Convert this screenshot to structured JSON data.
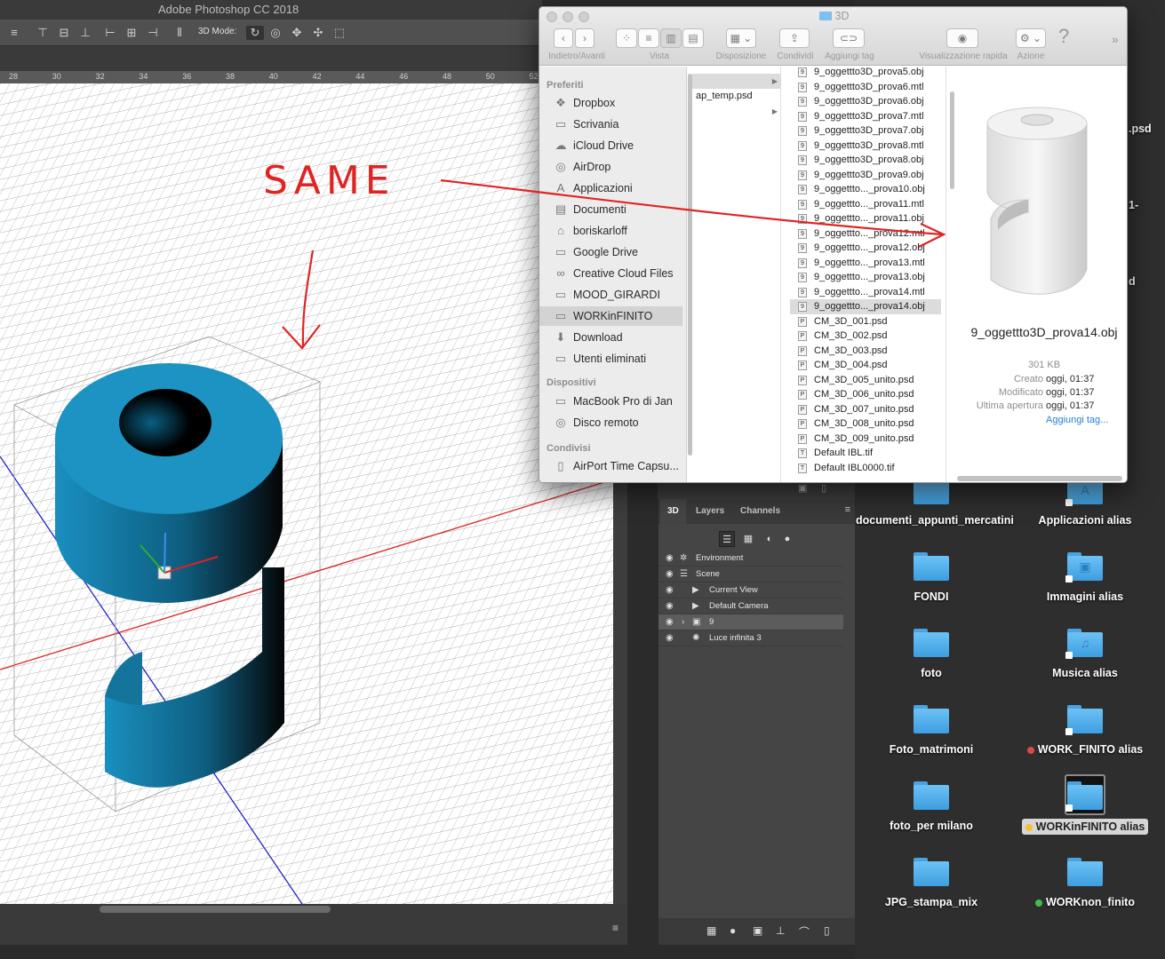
{
  "photoshop": {
    "title": "Adobe Photoshop CC 2018",
    "mode_label": "3D Mode:",
    "ruler_ticks": [
      "28",
      "30",
      "32",
      "34",
      "36",
      "38",
      "40",
      "42",
      "44",
      "46",
      "48",
      "50",
      "52"
    ],
    "panel_tabs": [
      "3D",
      "Layers",
      "Channels"
    ],
    "layers": [
      {
        "name": "Environment",
        "icon": "environment-icon"
      },
      {
        "name": "Scene",
        "icon": "scene-icon"
      },
      {
        "name": "Current View",
        "icon": "camera-icon"
      },
      {
        "name": "Default Camera",
        "icon": "camera-icon"
      },
      {
        "name": "9",
        "icon": "mesh-icon"
      },
      {
        "name": "Luce infinita 3",
        "icon": "light-icon"
      }
    ]
  },
  "annotation": {
    "text": "SAME"
  },
  "finder": {
    "title": "3D",
    "toolbar": {
      "back_forward": "Indietro/Avanti",
      "view": "Vista",
      "arrange": "Disposizione",
      "share": "Condividi",
      "tags": "Aggiungi tag",
      "quicklook": "Visualizzazione rapida",
      "action": "Azione"
    },
    "sidebar": {
      "favorites_header": "Preferiti",
      "favorites": [
        "Dropbox",
        "Scrivania",
        "iCloud Drive",
        "AirDrop",
        "Applicazioni",
        "Documenti",
        "boriskarloff",
        "Google Drive",
        "Creative Cloud Files",
        "MOOD_GIRARDI",
        "WORKinFINITO",
        "Download",
        "Utenti eliminati"
      ],
      "devices_header": "Dispositivi",
      "devices": [
        "MacBook Pro di Jan",
        "Disco remoto"
      ],
      "shared_header": "Condivisi",
      "shared": [
        "AirPort Time Capsu..."
      ]
    },
    "column1": [
      "ap_temp.psd"
    ],
    "files": [
      "9_oggettto3D_prova5.obj",
      "9_oggettto3D_prova6.mtl",
      "9_oggettto3D_prova6.obj",
      "9_oggettto3D_prova7.mtl",
      "9_oggettto3D_prova7.obj",
      "9_oggettto3D_prova8.mtl",
      "9_oggettto3D_prova8.obj",
      "9_oggettto3D_prova9.obj",
      "9_oggettto..._prova10.obj",
      "9_oggettto..._prova11.mtl",
      "9_oggettto..._prova11.obj",
      "9_oggettto..._prova12.mtl",
      "9_oggettto..._prova12.obj",
      "9_oggettto..._prova13.mtl",
      "9_oggettto..._prova13.obj",
      "9_oggettto..._prova14.mtl",
      "9_oggettto..._prova14.obj",
      "CM_3D_001.psd",
      "CM_3D_002.psd",
      "CM_3D_003.psd",
      "CM_3D_004.psd",
      "CM_3D_005_unito.psd",
      "CM_3D_006_unito.psd",
      "CM_3D_007_unito.psd",
      "CM_3D_008_unito.psd",
      "CM_3D_009_unito.psd",
      "Default IBL.tif",
      "Default IBL0000.tif"
    ],
    "preview": {
      "name": "9_oggettto3D_prova14.obj",
      "size": "301 KB",
      "created_label": "Creato",
      "created": "oggi, 01:37",
      "modified_label": "Modificato",
      "modified": "oggi, 01:37",
      "opened_label": "Ultima apertura",
      "opened": "oggi, 01:37",
      "add_tags": "Aggiungi tag..."
    }
  },
  "desktop": {
    "partial": [
      ".psd",
      "1-",
      "d"
    ],
    "icons": [
      {
        "label": "documenti_appunti_mercatini",
        "glyph": ""
      },
      {
        "label": "Applicazioni alias",
        "glyph": "A"
      },
      {
        "label": "FONDI",
        "glyph": ""
      },
      {
        "label": "Immagini alias",
        "glyph": "▣"
      },
      {
        "label": "foto",
        "glyph": ""
      },
      {
        "label": "Musica alias",
        "glyph": "♫"
      },
      {
        "label": "Foto_matrimoni",
        "glyph": ""
      },
      {
        "label": "WORK_FINITO alias",
        "glyph": "",
        "dot": "#e04848"
      },
      {
        "label": "foto_per milano",
        "glyph": ""
      },
      {
        "label": "WORKinFINITO alias",
        "glyph": "",
        "dot": "#f2c230",
        "selected": true
      },
      {
        "label": "JPG_stampa_mix",
        "glyph": ""
      },
      {
        "label": "WORKnon_finito",
        "glyph": "",
        "dot": "#3ec04a"
      }
    ]
  }
}
